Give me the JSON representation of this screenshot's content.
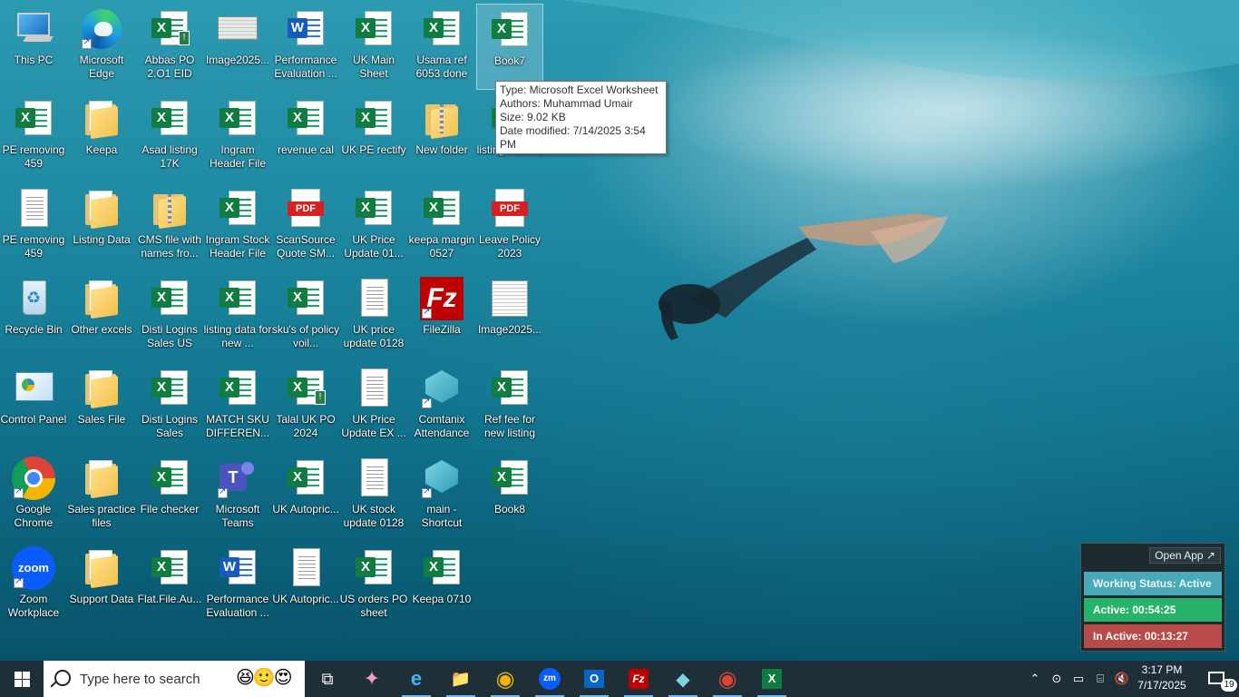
{
  "desktop": {
    "icons": [
      {
        "label": "This PC",
        "kind": "pc"
      },
      {
        "label": "Microsoft Edge",
        "kind": "edge",
        "shortcut": true
      },
      {
        "label": "Abbas PO 2.O1  EID",
        "kind": "excel-warn"
      },
      {
        "label": "Image2025...",
        "kind": "image-thumb"
      },
      {
        "label": "Performance Evaluation ...",
        "kind": "word"
      },
      {
        "label": "UK Main Sheet",
        "kind": "excel"
      },
      {
        "label": "Usama ref 6053 done",
        "kind": "excel"
      },
      {
        "label": "Book7",
        "kind": "excel",
        "selected": true
      },
      {
        "label": "PE removing 459",
        "kind": "excel"
      },
      {
        "label": "Keepa",
        "kind": "folder"
      },
      {
        "label": "Asad listing 17K",
        "kind": "excel"
      },
      {
        "label": "Ingram Header File",
        "kind": "excel"
      },
      {
        "label": "revenue cal",
        "kind": "excel"
      },
      {
        "label": "UK PE rectify",
        "kind": "excel"
      },
      {
        "label": "New folder",
        "kind": "zip"
      },
      {
        "label": "listing verified",
        "kind": "excel"
      },
      {
        "label": "PE removing 459",
        "kind": "doc"
      },
      {
        "label": "Listing Data",
        "kind": "folder"
      },
      {
        "label": "CMS file with names fro...",
        "kind": "zip"
      },
      {
        "label": "Ingram Stock Header File",
        "kind": "excel"
      },
      {
        "label": "ScanSource Quote SM...",
        "kind": "pdf"
      },
      {
        "label": "UK Price Update 01...",
        "kind": "excel"
      },
      {
        "label": "keepa margin 0527",
        "kind": "excel"
      },
      {
        "label": "Leave Policy 2023",
        "kind": "pdf"
      },
      {
        "label": "Recycle Bin",
        "kind": "recycle"
      },
      {
        "label": "Other excels",
        "kind": "folder"
      },
      {
        "label": "Disti Logins Sales US",
        "kind": "excel"
      },
      {
        "label": "listing data for new ...",
        "kind": "excel"
      },
      {
        "label": "sku's of policy voil...",
        "kind": "excel"
      },
      {
        "label": "UK price update 0128",
        "kind": "doc"
      },
      {
        "label": "FileZilla",
        "kind": "filezilla",
        "shortcut": true
      },
      {
        "label": "Image2025...",
        "kind": "image-sheet"
      },
      {
        "label": "Control Panel",
        "kind": "control"
      },
      {
        "label": "Sales File",
        "kind": "folder"
      },
      {
        "label": "Disti Logins Sales",
        "kind": "excel"
      },
      {
        "label": "MATCH SKU DIFFEREN...",
        "kind": "excel"
      },
      {
        "label": "Talal UK PO 2024",
        "kind": "excel-warn"
      },
      {
        "label": "UK Price Update EX ...",
        "kind": "doc"
      },
      {
        "label": "Comtanix Attendance",
        "kind": "comtanix",
        "shortcut": true
      },
      {
        "label": "Ref fee for new listing",
        "kind": "excel"
      },
      {
        "label": "Google Chrome",
        "kind": "chrome",
        "shortcut": true
      },
      {
        "label": "Sales practice files",
        "kind": "folder"
      },
      {
        "label": "File checker",
        "kind": "excel"
      },
      {
        "label": "Microsoft Teams",
        "kind": "teams",
        "shortcut": true
      },
      {
        "label": "UK Autopric...",
        "kind": "excel"
      },
      {
        "label": "UK stock update 0128",
        "kind": "doc"
      },
      {
        "label": "main - Shortcut",
        "kind": "comtanix",
        "shortcut": true
      },
      {
        "label": "Book8",
        "kind": "excel"
      },
      {
        "label": "Zoom Workplace",
        "kind": "zoom",
        "shortcut": true
      },
      {
        "label": "Support Data",
        "kind": "folder"
      },
      {
        "label": "Flat.File.Au...",
        "kind": "excel"
      },
      {
        "label": "Performance Evaluation ...",
        "kind": "word"
      },
      {
        "label": "UK Autopric...",
        "kind": "doc"
      },
      {
        "label": "US orders PO sheet",
        "kind": "excel"
      },
      {
        "label": "Keepa 0710",
        "kind": "excel"
      }
    ]
  },
  "tooltip": {
    "type": "Type: Microsoft Excel Worksheet",
    "authors": "Authors: Muhammad Umair",
    "size": "Size: 9.02 KB",
    "modified": "Date modified: 7/14/2025 3:54 PM"
  },
  "status_widget": {
    "open_app": "Open App ↗",
    "working_status": "Working Status: Active",
    "active": "Active: 00:54:25",
    "inactive": "In Active: 00:13:27"
  },
  "taskbar": {
    "search_placeholder": "Type here to search",
    "search_emoji": "😆🙂😍",
    "apps": [
      {
        "name": "task-view",
        "glyph": "⧉"
      },
      {
        "name": "copilot",
        "glyph": "✦"
      },
      {
        "name": "edge",
        "glyph": "e"
      },
      {
        "name": "file-explorer",
        "glyph": "📁"
      },
      {
        "name": "chrome",
        "glyph": "◉"
      },
      {
        "name": "zoom",
        "glyph": "zm"
      },
      {
        "name": "outlook",
        "glyph": "O"
      },
      {
        "name": "filezilla",
        "glyph": "Fz"
      },
      {
        "name": "comtanix",
        "glyph": "◆"
      },
      {
        "name": "chrome-profile",
        "glyph": "◉"
      },
      {
        "name": "excel",
        "glyph": "X"
      }
    ],
    "time": "3:17 PM",
    "date": "7/17/2025",
    "notification_count": "19"
  },
  "colors": {
    "excel": "#107c41",
    "word": "#185abd",
    "pdf": "#d9201f",
    "taskbar": "#1f2f37",
    "active_green": "#27b36a",
    "inactive_red": "#b84a4a"
  }
}
